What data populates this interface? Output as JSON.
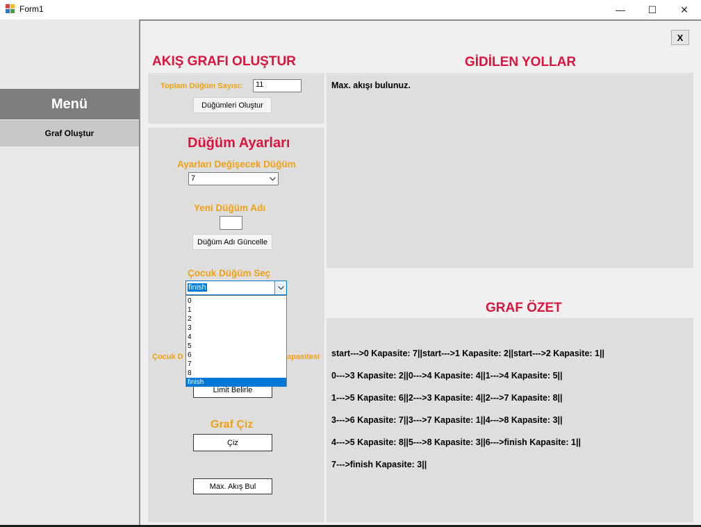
{
  "window": {
    "title": "Form1",
    "minimize": "—",
    "maximize": "☐",
    "close": "✕"
  },
  "sidebar": {
    "menu_title": "Menü",
    "items": [
      {
        "label": "Graf Oluştur"
      }
    ]
  },
  "main": {
    "close_label": "X"
  },
  "graph_create": {
    "title": "AKIŞ GRAFI OLUŞTUR",
    "node_count_label": "Toplam Düğüm Sayısı:",
    "node_count_value": "11",
    "create_nodes_button": "Düğümleri Oluştur"
  },
  "node_settings": {
    "title": "Düğüm Ayarları",
    "select_node_label": "Ayarları Değişecek Düğüm",
    "select_node_value": "7",
    "new_name_label": "Yeni Düğüm Adı",
    "new_name_value": "",
    "update_name_button": "Düğüm Adı Güncelle",
    "child_select_label": "Çocuk Düğüm Seç",
    "child_select_value": "finish",
    "child_options": [
      "0",
      "1",
      "2",
      "3",
      "4",
      "5",
      "6",
      "7",
      "8",
      "finish"
    ],
    "capacity_label_left": "Çocuk D",
    "capacity_label_right": "apasitesi",
    "limit_button": "Limit Belirle",
    "draw_title": "Graf Çiz",
    "draw_button": "Çiz",
    "max_flow_button": "Max. Akış Bul"
  },
  "paths": {
    "title": "GİDİLEN YOLLAR",
    "text": "Max. akışı bulunuz."
  },
  "summary": {
    "title": "GRAF ÖZET",
    "lines": [
      "start--->0 Kapasite: 7||start--->1 Kapasite: 2||start--->2 Kapasite: 1||",
      "0--->3 Kapasite: 2||0--->4 Kapasite: 4||1--->4 Kapasite: 5||",
      "1--->5 Kapasite: 6||2--->3 Kapasite: 4||2--->7 Kapasite: 8||",
      "3--->6 Kapasite: 7||3--->7 Kapasite: 1||4--->8 Kapasite: 3||",
      "4--->5 Kapasite: 8||5--->8 Kapasite: 3||6--->finish Kapasite: 1||",
      "7--->finish Kapasite: 3||"
    ]
  }
}
